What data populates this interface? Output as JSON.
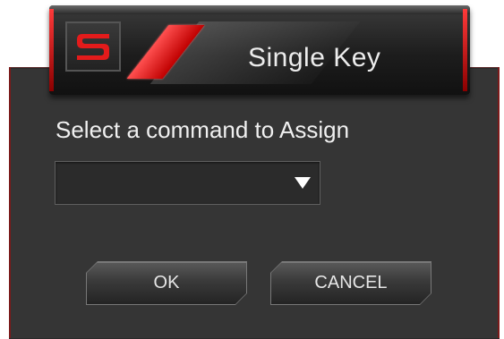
{
  "header": {
    "title": "Single Key",
    "logo_letter": "S"
  },
  "main": {
    "prompt_label": "Select a command to Assign",
    "command_select": {
      "selected_value": ""
    }
  },
  "buttons": {
    "ok_label": "OK",
    "cancel_label": "CANCEL"
  },
  "colors": {
    "accent_red": "#e02020",
    "panel_bg": "#353535",
    "text": "#f0f0f0"
  },
  "icons": {
    "logo": "brand-s-logo-icon",
    "dropdown_arrow": "chevron-down-icon"
  }
}
